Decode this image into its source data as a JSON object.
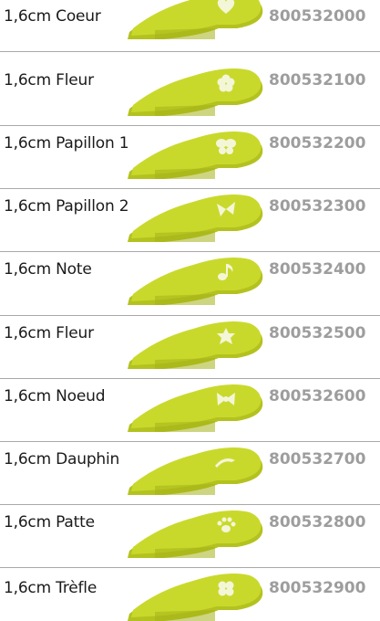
{
  "colors": {
    "punch_fill": "#c9d92c",
    "punch_shade": "#b3c21f",
    "punch_dark": "#a4b218",
    "code_color": "#9d9d9d",
    "divider": "#a9a9a9"
  },
  "items": [
    {
      "label": "1,6cm Coeur",
      "code": "800532000",
      "shape": "heart-icon"
    },
    {
      "label": "1,6cm Fleur",
      "code": "800532100",
      "shape": "flower-icon"
    },
    {
      "label": "1,6cm Papillon 1",
      "code": "800532200",
      "shape": "butterfly-icon"
    },
    {
      "label": "1,6cm Papillon 2",
      "code": "800532300",
      "shape": "butterfly-alt-icon"
    },
    {
      "label": "1,6cm Note",
      "code": "800532400",
      "shape": "music-note-icon"
    },
    {
      "label": "1,6cm Fleur",
      "code": "800532500",
      "shape": "flower-alt-icon"
    },
    {
      "label": "1,6cm Noeud",
      "code": "800532600",
      "shape": "bow-icon"
    },
    {
      "label": "1,6cm Dauphin",
      "code": "800532700",
      "shape": "dolphin-icon"
    },
    {
      "label": "1,6cm Patte",
      "code": "800532800",
      "shape": "paw-icon"
    },
    {
      "label": "1,6cm Trèfle",
      "code": "800532900",
      "shape": "clover-icon"
    }
  ]
}
